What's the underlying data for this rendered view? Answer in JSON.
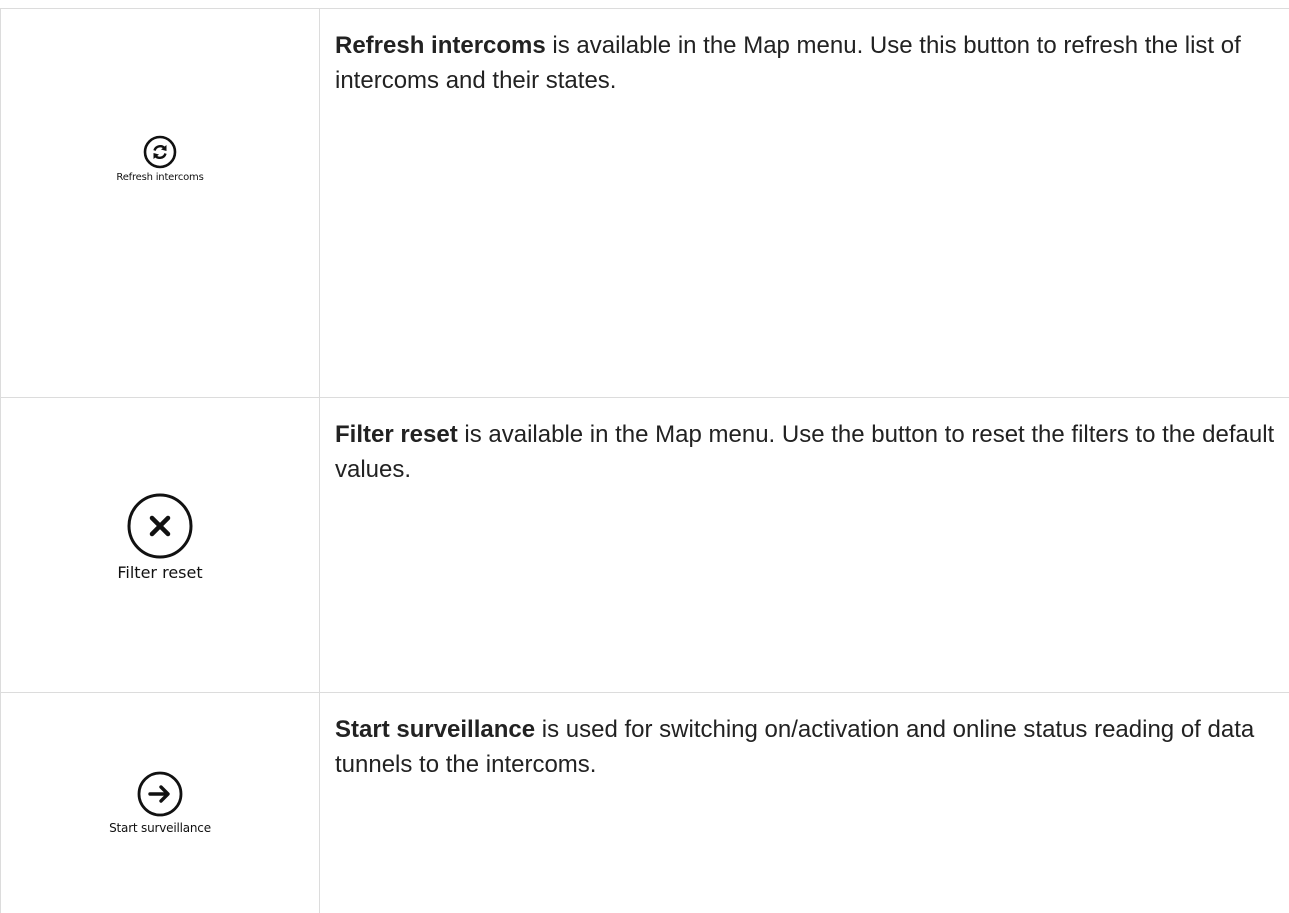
{
  "rows": [
    {
      "icon": "refresh-icon",
      "caption": "Refresh intercoms",
      "title": "Refresh intercoms",
      "description": " is available in the Map menu. Use this button to refresh the list of intercoms and their states."
    },
    {
      "icon": "close-icon",
      "caption": "Filter reset",
      "title": "Filter reset",
      "description": " is available in the Map menu. Use the button to reset the filters to the default values."
    },
    {
      "icon": "arrow-right-icon",
      "caption": "Start surveillance",
      "title": "Start surveillance",
      "description": " is used for switching on/activation and online status reading of data tunnels to the intercoms."
    }
  ]
}
